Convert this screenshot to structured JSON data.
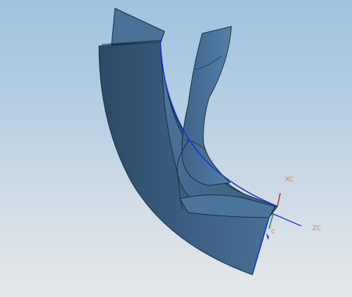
{
  "viewport": {
    "axes": {
      "x_label": "XC",
      "z_label": "ZC",
      "y_label": "C",
      "x_color": "#c0322a",
      "y_color": "#2e8b3a",
      "z_color": "#1f2fd0",
      "label_color": "#e07b39"
    },
    "model": {
      "surface_color": "#3f6488",
      "edge_color": "#1a2a3a",
      "highlight_edge_color": "#1633d8"
    }
  }
}
